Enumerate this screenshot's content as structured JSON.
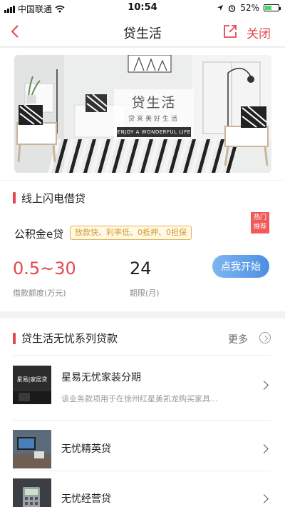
{
  "status": {
    "carrier": "中国联通",
    "time": "10:54",
    "battery": "52%",
    "battery_level": 0.52
  },
  "nav": {
    "title": "贷生活",
    "close_label": "关闭",
    "back_icon": "chevron-left-icon",
    "share_icon": "share-icon"
  },
  "banner": {
    "title": "贷生活",
    "subtitle": "贷来美好生活",
    "tagline": "ENJOY A WONDERFUL LIFE"
  },
  "flash_loan": {
    "section_title": "线上闪电借贷",
    "product_name": "公积金e贷",
    "features": "放款快、利率低、0抵押、0担保",
    "hot_badge": [
      "热门",
      "推荐"
    ],
    "amount": "0.5~30",
    "amount_label": "借款额度(万元)",
    "period": "24",
    "period_label": "期限(月)",
    "start_button": "点我开始"
  },
  "series": {
    "section_title": "贷生活无忧系列贷款",
    "more_label": "更多",
    "items": [
      {
        "title": "星易无忧家装分期",
        "desc": "该业务款项用于在徐州红星美凯龙购买家具...",
        "thumb_text": "星易|家居贷"
      },
      {
        "title": "无忧精英贷"
      },
      {
        "title": "无忧经营贷"
      }
    ]
  },
  "colors": {
    "accent": "#e4474f",
    "button": "#4c8fe3",
    "tag": "#d49a2a"
  }
}
